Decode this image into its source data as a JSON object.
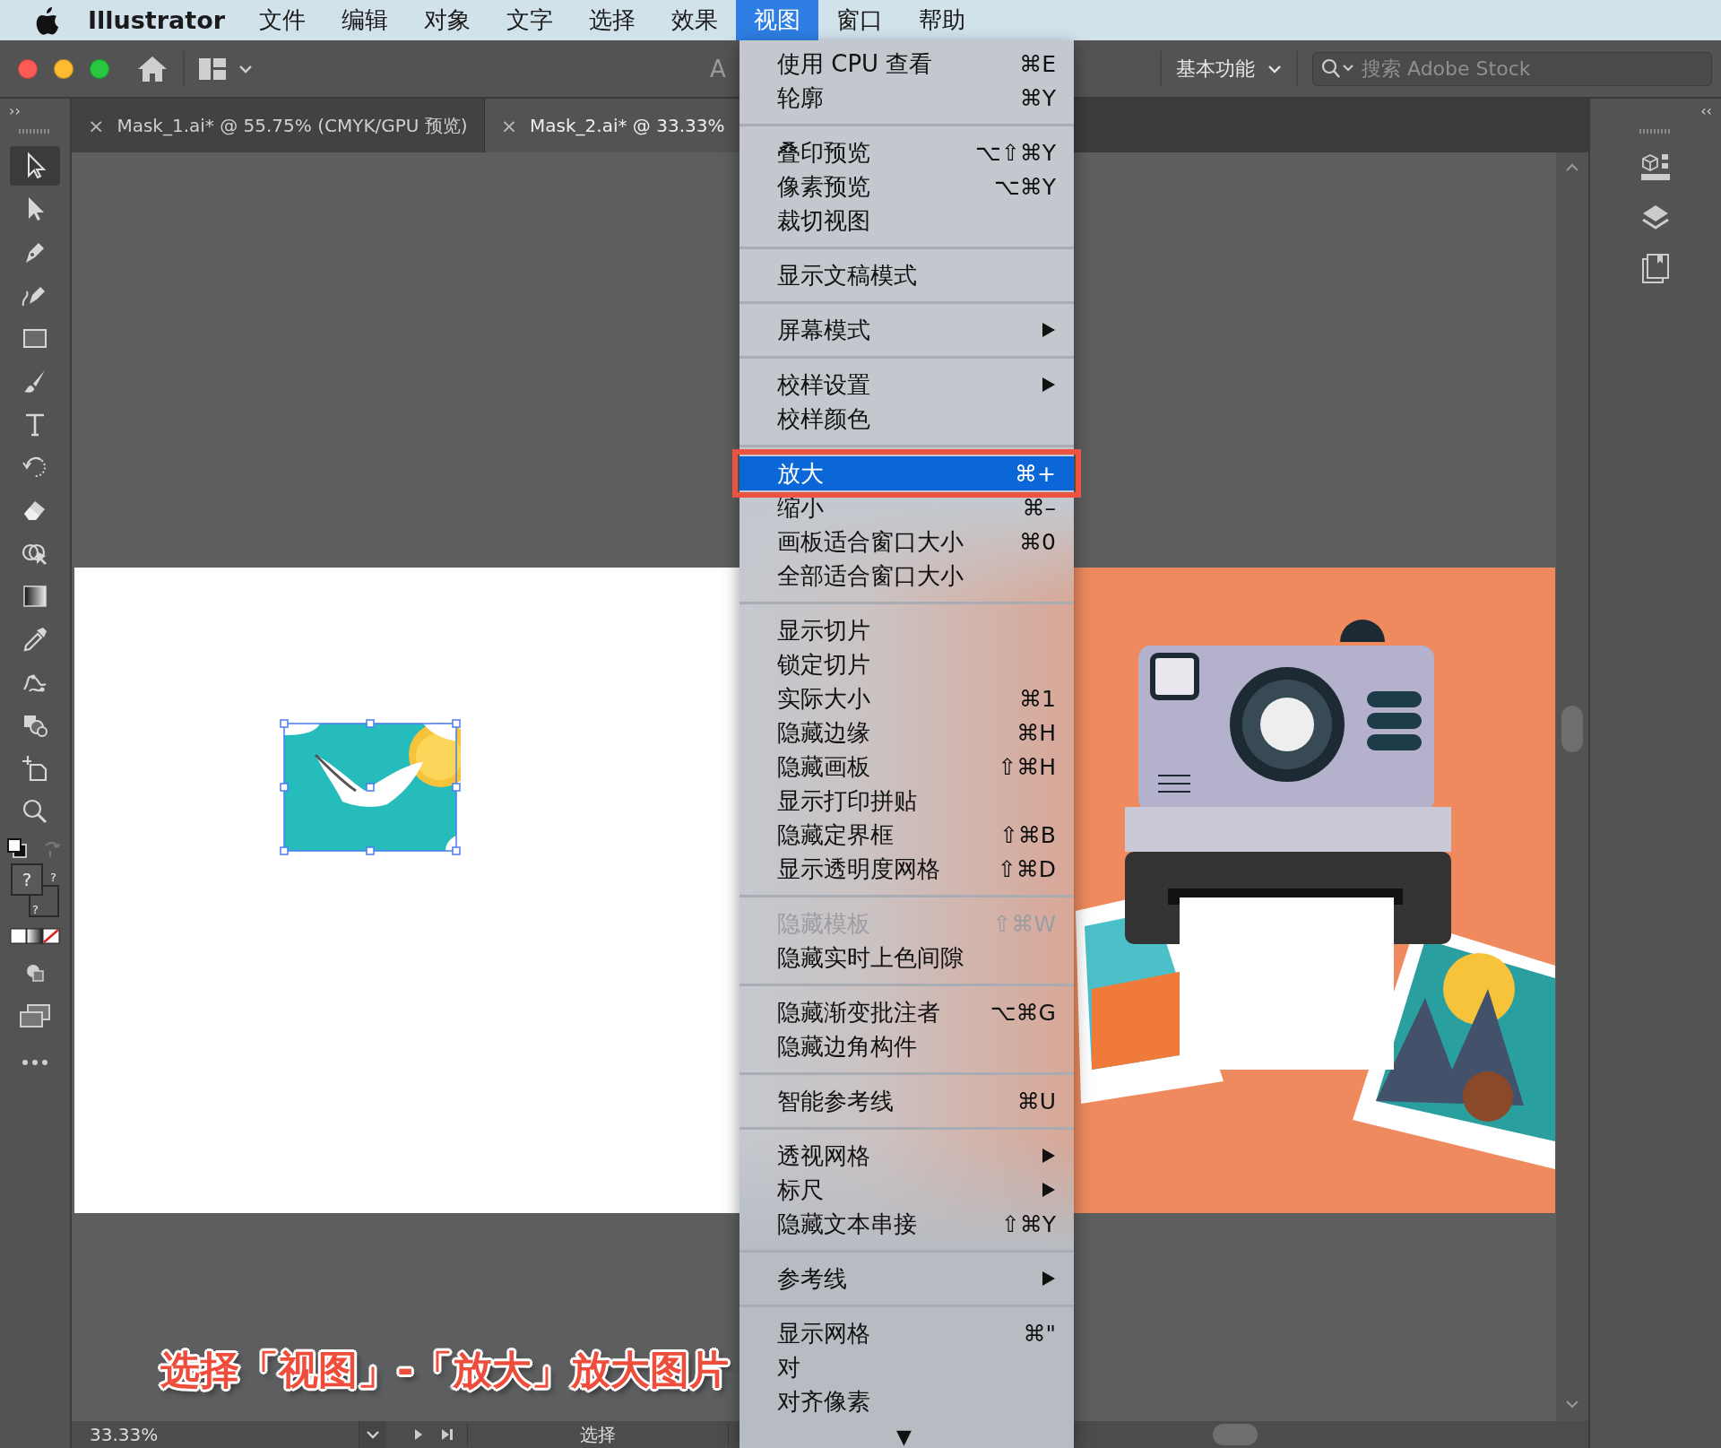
{
  "menu_bar": {
    "app_name": "Illustrator",
    "items": [
      {
        "label": "文件",
        "selected": false
      },
      {
        "label": "编辑",
        "selected": false
      },
      {
        "label": "对象",
        "selected": false
      },
      {
        "label": "文字",
        "selected": false
      },
      {
        "label": "选择",
        "selected": false
      },
      {
        "label": "效果",
        "selected": false
      },
      {
        "label": "视图",
        "selected": true
      },
      {
        "label": "窗口",
        "selected": false
      },
      {
        "label": "帮助",
        "selected": false
      }
    ]
  },
  "toolbar": {
    "partial_title": "A",
    "workspace": "基本功能",
    "search": {
      "placeholder": "搜索 Adobe Stock"
    }
  },
  "panel_toggles": {
    "left": "››",
    "right": "‹‹"
  },
  "tabs": [
    {
      "close": "×",
      "label": "Mask_1.ai* @ 55.75% (CMYK/GPU 预览)",
      "selected": false
    },
    {
      "close": "×",
      "label": "Mask_2.ai* @ 33.33%",
      "selected": true
    }
  ],
  "tools": [
    {
      "kind": "selection",
      "selected": true
    },
    {
      "kind": "direct-selection",
      "selected": false
    },
    {
      "kind": "pen",
      "selected": false
    },
    {
      "kind": "curvature",
      "selected": false
    },
    {
      "kind": "rectangle",
      "selected": false
    },
    {
      "kind": "paintbrush",
      "selected": false
    },
    {
      "kind": "type",
      "selected": false
    },
    {
      "kind": "rotate",
      "selected": false
    },
    {
      "kind": "eraser",
      "selected": false
    },
    {
      "kind": "shape-builder",
      "selected": false
    },
    {
      "kind": "gradient",
      "selected": false
    },
    {
      "kind": "eyedropper",
      "selected": false
    },
    {
      "kind": "puppet-warp",
      "selected": false
    },
    {
      "kind": "shapes",
      "selected": false
    },
    {
      "kind": "artboard",
      "selected": false
    },
    {
      "kind": "zoom",
      "selected": false
    }
  ],
  "fill_stroke_marks": [
    "?",
    "?",
    "?"
  ],
  "view_menu": {
    "groups": [
      {
        "items": [
          {
            "label": "使用 CPU 查看",
            "shortcut": "⌘E",
            "kind": "command",
            "disabled": false,
            "selected": false
          },
          {
            "label": "轮廓",
            "shortcut": "⌘Y",
            "kind": "command",
            "disabled": false,
            "selected": false
          }
        ]
      },
      {
        "items": [
          {
            "label": "叠印预览",
            "shortcut": "⌥⇧⌘Y",
            "kind": "command",
            "disabled": false,
            "selected": false
          },
          {
            "label": "像素预览",
            "shortcut": "⌥⌘Y",
            "kind": "command",
            "disabled": false,
            "selected": false
          },
          {
            "label": "裁切视图",
            "kind": "command",
            "disabled": false,
            "selected": false
          }
        ]
      },
      {
        "items": [
          {
            "label": "显示文稿模式",
            "kind": "command",
            "disabled": false,
            "selected": false
          }
        ]
      },
      {
        "items": [
          {
            "label": "屏幕模式",
            "kind": "submenu",
            "disabled": false,
            "selected": false
          }
        ]
      },
      {
        "items": [
          {
            "label": "校样设置",
            "kind": "submenu",
            "disabled": false,
            "selected": false
          },
          {
            "label": "校样颜色",
            "kind": "command",
            "disabled": false,
            "selected": false
          }
        ]
      },
      {
        "items": [
          {
            "label": "放大",
            "shortcut": "⌘+",
            "kind": "command",
            "disabled": false,
            "selected": true
          },
          {
            "label": "缩小",
            "shortcut": "⌘–",
            "kind": "command",
            "disabled": false,
            "selected": false
          },
          {
            "label": "画板适合窗口大小",
            "shortcut": "⌘0",
            "kind": "command",
            "disabled": false,
            "selected": false
          },
          {
            "label": "全部适合窗口大小",
            "kind": "command",
            "disabled": false,
            "selected": false
          }
        ]
      },
      {
        "items": [
          {
            "label": "显示切片",
            "kind": "command",
            "disabled": false,
            "selected": false
          },
          {
            "label": "锁定切片",
            "kind": "command",
            "disabled": false,
            "selected": false
          },
          {
            "label": "实际大小",
            "shortcut": "⌘1",
            "kind": "command",
            "disabled": false,
            "selected": false
          },
          {
            "label": "隐藏边缘",
            "shortcut": "⌘H",
            "kind": "command",
            "disabled": false,
            "selected": false
          },
          {
            "label": "隐藏画板",
            "shortcut": "⇧⌘H",
            "kind": "command",
            "disabled": false,
            "selected": false
          },
          {
            "label": "显示打印拼贴",
            "kind": "command",
            "disabled": false,
            "selected": false
          },
          {
            "label": "隐藏定界框",
            "shortcut": "⇧⌘B",
            "kind": "command",
            "disabled": false,
            "selected": false
          },
          {
            "label": "显示透明度网格",
            "shortcut": "⇧⌘D",
            "kind": "command",
            "disabled": false,
            "selected": false
          }
        ]
      },
      {
        "items": [
          {
            "label": "隐藏模板",
            "shortcut": "⇧⌘W",
            "kind": "command",
            "disabled": true,
            "selected": false
          },
          {
            "label": "隐藏实时上色间隙",
            "kind": "command",
            "disabled": false,
            "selected": false
          }
        ]
      },
      {
        "items": [
          {
            "label": "隐藏渐变批注者",
            "shortcut": "⌥⌘G",
            "kind": "command",
            "disabled": false,
            "selected": false
          },
          {
            "label": "隐藏边角构件",
            "kind": "command",
            "disabled": false,
            "selected": false
          }
        ]
      },
      {
        "items": [
          {
            "label": "智能参考线",
            "shortcut": "⌘U",
            "kind": "command",
            "disabled": false,
            "selected": false
          }
        ]
      },
      {
        "items": [
          {
            "label": "透视网格",
            "kind": "submenu",
            "disabled": false,
            "selected": false
          },
          {
            "label": "标尺",
            "kind": "submenu",
            "disabled": false,
            "selected": false
          },
          {
            "label": "隐藏文本串接",
            "shortcut": "⇧⌘Y",
            "kind": "command",
            "disabled": false,
            "selected": false
          }
        ]
      },
      {
        "items": [
          {
            "label": "参考线",
            "kind": "submenu",
            "disabled": false,
            "selected": false
          }
        ]
      },
      {
        "items": [
          {
            "label": "显示网格",
            "shortcut": "⌘\"",
            "kind": "command",
            "disabled": false,
            "selected": false
          },
          {
            "label": "对",
            "kind": "command",
            "disabled": false,
            "selected": false
          },
          {
            "label": "对齐像素",
            "kind": "command",
            "disabled": false,
            "selected": false
          }
        ]
      }
    ],
    "scroll_arrow": "▼"
  },
  "status_bar": {
    "zoom": "33.33%",
    "mode": "选择"
  },
  "caption": "选择「视图」-「放大」放大图片"
}
